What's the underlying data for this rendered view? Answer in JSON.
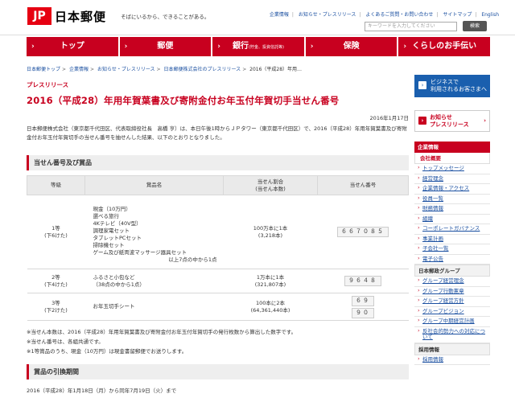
{
  "header": {
    "logo_mark": "JP",
    "logo_text": "日本郵便",
    "tagline": "そばにいるから、できることがある。",
    "links": [
      "企業情報",
      "お知らせ・プレスリリース",
      "よくあるご質問・お問い合わせ",
      "サイトマップ",
      "English"
    ],
    "search_placeholder": "キーワードを入力してください",
    "search_button": "検索"
  },
  "nav": [
    {
      "label": "トップ",
      "sub": ""
    },
    {
      "label": "郵便",
      "sub": ""
    },
    {
      "label": "銀行",
      "sub": "(貯金、投資信託等)"
    },
    {
      "label": "保険",
      "sub": ""
    },
    {
      "label": "くらしのお手伝い",
      "sub": ""
    }
  ],
  "breadcrumb": [
    "日本郵便トップ",
    "企業情報",
    "お知らせ・プレスリリース",
    "日本郵便株式会社のプレスリリース",
    "2016（平成28）年用…"
  ],
  "main": {
    "section_label": "プレスリリース",
    "title": "2016（平成28）年用年賀葉書及び寄附金付お年玉付年賀切手当せん番号",
    "date": "2016年1月17日",
    "intro": "日本郵便株式会社（東京都千代田区、代表取締役社長　高橋 亨）は、本日午後1時からＪＰタワー（東京都千代田区）で、2016（平成28）年用年賀葉書及び寄附金付お年玉付年賀切手の当せん番号を抽せんした結果、以下のとおりとなりました。",
    "heading1": "当せん番号及び賞品",
    "table": {
      "headers": [
        "等級",
        "賞品名",
        "当せん割合\n(当せん本数)",
        "当せん番号"
      ],
      "rows": [
        {
          "grade": "1等",
          "grade_sub": "(下6けた)",
          "prizes": [
            "現金（10万円）",
            "選べる旅行",
            "4Kテレビ（40V型）",
            "調理家電セット",
            "タブレットPCセット",
            "掃除機セット",
            "ゲーム及び紙両波マッサージ器具セット"
          ],
          "prize_note": "以上7点の中から1点",
          "ratio": "100万本に1本",
          "count": "(3,218本)",
          "numbers": [
            "６６７０８５"
          ]
        },
        {
          "grade": "2等",
          "grade_sub": "(下4けた)",
          "prizes": [
            "ふるさと小包など",
            "（38点の中から1点）"
          ],
          "prize_note": "",
          "ratio": "1万本に1本",
          "count": "(321,807本)",
          "numbers": [
            "９６４８"
          ]
        },
        {
          "grade": "3等",
          "grade_sub": "(下2けた)",
          "prizes": [
            "お年玉切手シート"
          ],
          "prize_note": "",
          "ratio": "100本に2本",
          "count": "(64,361,440本)",
          "numbers": [
            "６９",
            "９０"
          ]
        }
      ]
    },
    "notes": [
      "※当せん本数は、2016（平成28）年用年賀葉書及び寄附金付お年玉付年賀切手の発行枚数から算出した数字です。",
      "※当せん番号は、各組共通です。",
      "※1等賞品のうち、現金（10万円）は現金書留郵便でお送りします。"
    ],
    "heading2": "賞品の引換期間",
    "exchange": "2016（平成28）年1月18日（月）から同年7月19日（火）まで"
  },
  "sidebar": {
    "biz_button": "ビジネスで\n利用されるお客さまへ",
    "news_button": "お知らせ\nプレスリリース",
    "corp_head": "企業情報",
    "corp_sub": "会社概要",
    "corp_items": [
      "トップメッセージ",
      "経営理念",
      "企業情報・アクセス",
      "役員一覧",
      "財務情報",
      "組織",
      "コーポレートガバナンス",
      "事業計画",
      "子会社一覧",
      "電子公告"
    ],
    "group_head": "日本郵政グループ",
    "group_items": [
      "グループ経営理念",
      "グループ行動憲章",
      "グループ経営方針",
      "グループビジョン",
      "グループ中期経営計画",
      "反社会的勢力への対応について"
    ],
    "recruit_head": "採用情報",
    "recruit_items": [
      "採用情報"
    ]
  }
}
